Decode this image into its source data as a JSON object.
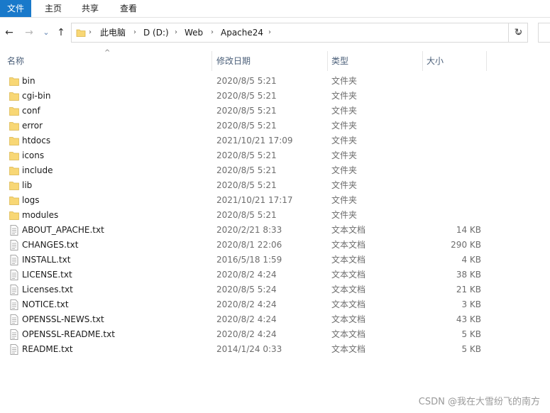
{
  "ribbon": {
    "tabs": [
      {
        "label": "文件"
      },
      {
        "label": "主页"
      },
      {
        "label": "共享"
      },
      {
        "label": "查看"
      }
    ]
  },
  "nav": {
    "back": "←",
    "forward": "→",
    "recent": "⌄",
    "up": "↑",
    "breadcrumbs": [
      "此电脑",
      "D (D:)",
      "Web",
      "Apache24"
    ],
    "separator": "›",
    "dropdown": "⌄",
    "refresh": "↻"
  },
  "columns": {
    "name": "名称",
    "date": "修改日期",
    "type": "类型",
    "size": "大小",
    "sort_indicator": "^"
  },
  "files": [
    {
      "name": "bin",
      "date": "2020/8/5 5:21",
      "type": "文件夹",
      "size": "",
      "icon": "folder-icon"
    },
    {
      "name": "cgi-bin",
      "date": "2020/8/5 5:21",
      "type": "文件夹",
      "size": "",
      "icon": "folder-icon"
    },
    {
      "name": "conf",
      "date": "2020/8/5 5:21",
      "type": "文件夹",
      "size": "",
      "icon": "folder-icon"
    },
    {
      "name": "error",
      "date": "2020/8/5 5:21",
      "type": "文件夹",
      "size": "",
      "icon": "folder-icon"
    },
    {
      "name": "htdocs",
      "date": "2021/10/21 17:09",
      "type": "文件夹",
      "size": "",
      "icon": "folder-icon"
    },
    {
      "name": "icons",
      "date": "2020/8/5 5:21",
      "type": "文件夹",
      "size": "",
      "icon": "folder-icon"
    },
    {
      "name": "include",
      "date": "2020/8/5 5:21",
      "type": "文件夹",
      "size": "",
      "icon": "folder-icon"
    },
    {
      "name": "lib",
      "date": "2020/8/5 5:21",
      "type": "文件夹",
      "size": "",
      "icon": "folder-icon"
    },
    {
      "name": "logs",
      "date": "2021/10/21 17:17",
      "type": "文件夹",
      "size": "",
      "icon": "folder-icon"
    },
    {
      "name": "modules",
      "date": "2020/8/5 5:21",
      "type": "文件夹",
      "size": "",
      "icon": "folder-icon"
    },
    {
      "name": "ABOUT_APACHE.txt",
      "date": "2020/2/21 8:33",
      "type": "文本文档",
      "size": "14 KB",
      "icon": "text-file-icon"
    },
    {
      "name": "CHANGES.txt",
      "date": "2020/8/1 22:06",
      "type": "文本文档",
      "size": "290 KB",
      "icon": "text-file-icon"
    },
    {
      "name": "INSTALL.txt",
      "date": "2016/5/18 1:59",
      "type": "文本文档",
      "size": "4 KB",
      "icon": "text-file-icon"
    },
    {
      "name": "LICENSE.txt",
      "date": "2020/8/2 4:24",
      "type": "文本文档",
      "size": "38 KB",
      "icon": "text-file-icon"
    },
    {
      "name": "Licenses.txt",
      "date": "2020/8/5 5:24",
      "type": "文本文档",
      "size": "21 KB",
      "icon": "text-file-icon"
    },
    {
      "name": "NOTICE.txt",
      "date": "2020/8/2 4:24",
      "type": "文本文档",
      "size": "3 KB",
      "icon": "text-file-icon"
    },
    {
      "name": "OPENSSL-NEWS.txt",
      "date": "2020/8/2 4:24",
      "type": "文本文档",
      "size": "43 KB",
      "icon": "text-file-icon"
    },
    {
      "name": "OPENSSL-README.txt",
      "date": "2020/8/2 4:24",
      "type": "文本文档",
      "size": "5 KB",
      "icon": "text-file-icon"
    },
    {
      "name": "README.txt",
      "date": "2014/1/24 0:33",
      "type": "文本文档",
      "size": "5 KB",
      "icon": "text-file-icon"
    }
  ],
  "watermark": "CSDN @我在大雪纷飞的南方",
  "colors": {
    "accent": "#1979ca",
    "folder": "#f8d775",
    "header_text": "#4c607a"
  }
}
